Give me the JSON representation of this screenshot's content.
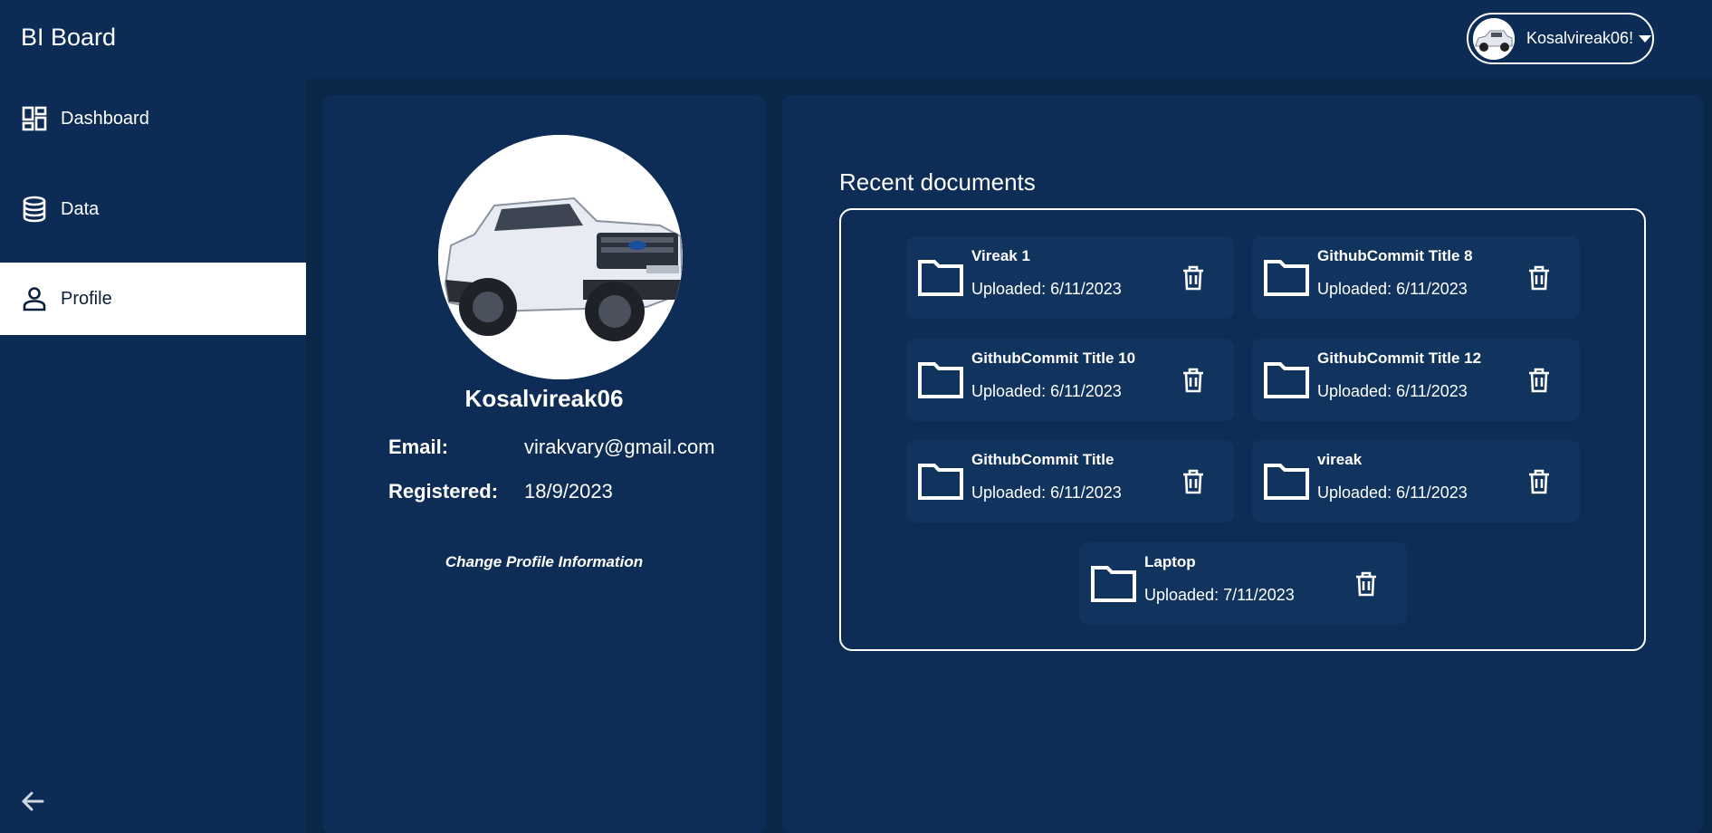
{
  "app": {
    "title": "BI Board"
  },
  "user_menu": {
    "name": "Kosalvireak06!"
  },
  "sidebar": {
    "items": [
      {
        "label": "Dashboard",
        "icon": "dashboard-icon"
      },
      {
        "label": "Data",
        "icon": "database-icon"
      },
      {
        "label": "Profile",
        "icon": "person-icon",
        "active": true
      }
    ],
    "collapse_icon": "arrow-left-icon"
  },
  "profile": {
    "username": "Kosalvireak06",
    "email_label": "Email:",
    "email_value": "virakvary@gmail.com",
    "registered_label": "Registered:",
    "registered_value": "18/9/2023",
    "change_link": "Change Profile Information"
  },
  "documents": {
    "heading": "Recent documents",
    "items": [
      {
        "title": "Vireak 1",
        "uploaded": "Uploaded: 6/11/2023"
      },
      {
        "title": "GithubCommit Title 8",
        "uploaded": "Uploaded: 6/11/2023"
      },
      {
        "title": "GithubCommit Title 10",
        "uploaded": "Uploaded: 6/11/2023"
      },
      {
        "title": "GithubCommit Title 12",
        "uploaded": "Uploaded: 6/11/2023"
      },
      {
        "title": "GithubCommit Title",
        "uploaded": "Uploaded: 6/11/2023"
      },
      {
        "title": "vireak",
        "uploaded": "Uploaded: 6/11/2023"
      },
      {
        "title": "Laptop",
        "uploaded": "Uploaded: 7/11/2023"
      }
    ]
  },
  "colors": {
    "background": "#0d2c55",
    "main_background": "#0a2748",
    "card": "#0d2d56",
    "doc_tile": "#11345f",
    "active_nav": "#ffffff",
    "text": "#ffffff"
  }
}
